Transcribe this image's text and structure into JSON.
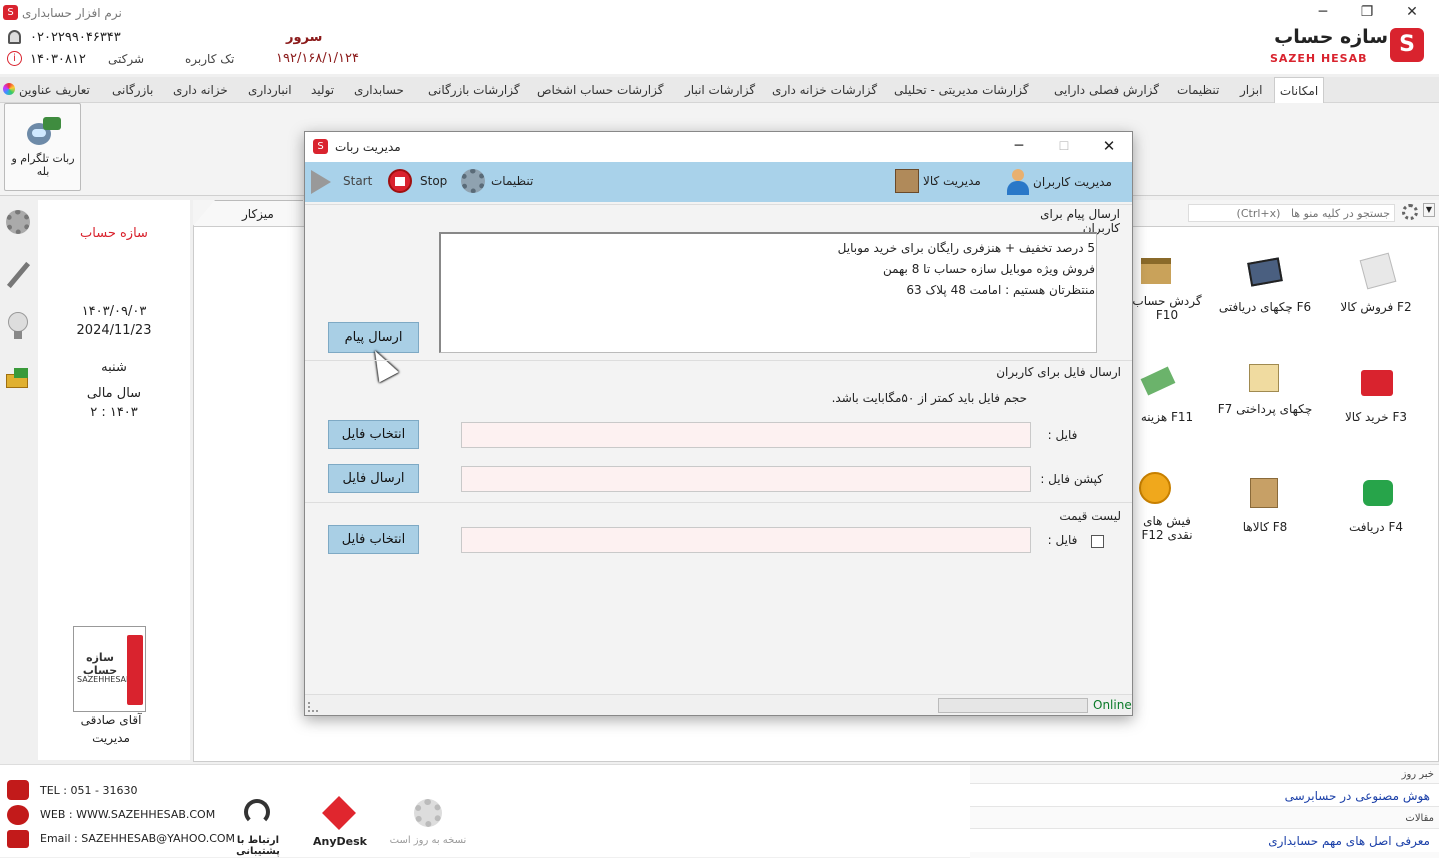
{
  "app": {
    "title": "نرم افزار حسابداری",
    "logo_fa": "سازه حساب",
    "logo_en": "SAZEH HESAB"
  },
  "info": {
    "phone": "۰۲۰۲۲۹۹۰۴۶۳۴۳",
    "company_label": "شرکتی",
    "single_user": "تک کاربره",
    "date_code": "۱۴۰۳۰۸۱۲",
    "server_label": "سرور",
    "server_ip": "۱۹۲/۱۶۸/۱/۱۲۴"
  },
  "menu": {
    "tabs": [
      "امکانات",
      "ابزار",
      "تنظیمات",
      "گزارش فصلی دارایی",
      "گزارشات مدیریتی - تحلیلی",
      "گزارشات خزانه داری",
      "گزارشات انبار",
      "گزارشات حساب اشخاص",
      "گزارشات بازرگانی",
      "حسابداری",
      "تولید",
      "انبارداری",
      "خزانه داری",
      "بازرگانی",
      "تعاریف عناوین"
    ]
  },
  "ribbon": {
    "telegram_label": "ربات تلگرام و بله"
  },
  "left": {
    "brand": "سازه حساب",
    "date_fa": "۱۴۰۳/۰۹/۰۳",
    "date_en": "2024/11/23",
    "weekday": "شنبه",
    "fiscal_label": "سال مالی",
    "fiscal_value": "۲ : ۱۴۰۳",
    "user_name": "آقای صادقی",
    "user_role": "مدیریت",
    "card_fa": "سازه حساب",
    "card_en": "SAZEHHESAB"
  },
  "desktop": {
    "tab_label": "میزکار",
    "search_placeholder": "جستجو در کلیه منو ها   (Ctrl+x)",
    "shortcuts": [
      {
        "label": "F2   فروش کالا",
        "icon": "sales-icon"
      },
      {
        "label": "F6   چکهای دریافتی",
        "icon": "received-checks-icon"
      },
      {
        "label": "گردش حساب F10",
        "icon": "account-turnover-icon"
      },
      {
        "label": "F3   خرید کالا",
        "icon": "purchase-icon"
      },
      {
        "label": "چکهای پرداختی F7",
        "icon": "paid-checks-icon"
      },
      {
        "label": "F11   هزینه",
        "icon": "expense-icon"
      },
      {
        "label": "F4   دریافت",
        "icon": "receive-icon"
      },
      {
        "label": "F8   کالاها",
        "icon": "goods-icon"
      },
      {
        "label": "فیش های نقدی F12",
        "icon": "cash-slip-icon"
      }
    ]
  },
  "dialog": {
    "title": "مدیریت ربات",
    "toolbar": {
      "start": "Start",
      "stop": "Stop",
      "settings": "تنظیمات",
      "goods": "مدیریت کالا",
      "users": "مدیریت کاربران"
    },
    "sec1": {
      "title": "ارسال پیام برای کاربران",
      "lines": [
        "5 درصد تخفیف + هنزفری رایگان برای خرید موبایل",
        "فروش ویژه موبایل سازه حساب تا 8 بهمن",
        "منتظرتان هستیم : امامت 48 پلاک 63"
      ],
      "send_button": "ارسال پیام"
    },
    "sec2": {
      "title": "ارسال فایل برای کاربران",
      "note": "حجم فایل باید کمتر از ۵۰مگابایت باشد.",
      "file_label": "فایل :",
      "caption_label": "کپشن فایل :",
      "choose_button": "انتخاب فایل",
      "send_button": "ارسال فایل"
    },
    "sec3": {
      "title": "لیست قیمت",
      "file_label": "فایل :",
      "choose_button": "انتخاب فایل"
    },
    "status": "Online"
  },
  "footer": {
    "tel": "TEL : 051 - 31630",
    "web": "WEB : WWW.SAZEHHESAB.COM",
    "email": "Email : SAZEHHESAB@YAHOO.COM",
    "support": "ارتباط با پشتیبانی",
    "anydesk": "AnyDesk",
    "update": "نسخه به روز است",
    "news_title": "خبر روز",
    "news_item": "هوش مصنوعی در حسابرسی",
    "articles_title": "مقالات",
    "article_item": "معرفی اصل های مهم حسابداری"
  },
  "colors": {
    "accent": "#d9232e",
    "toolbar_blue": "#a9d2ea",
    "button_blue": "#a9cfe5",
    "field_pink": "#fdf1f1",
    "link_blue": "#1a3fa8",
    "online_green": "#0a7a28"
  }
}
